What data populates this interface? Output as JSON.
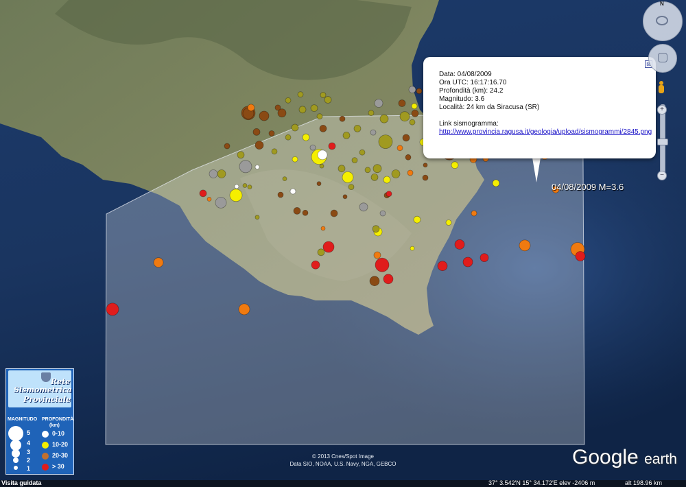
{
  "map": {
    "features": [
      "coastline",
      "land",
      "sea",
      "coverage-area"
    ]
  },
  "popup": {
    "data_line": "Data: 04/08/2009",
    "ora_line": "Ora UTC: 16:17:16.70",
    "profondita_line": "Profondità (km): 24.2",
    "magnitudo_line": "Magnitudo: 3.6",
    "localita_line": "Località: 24 km da Siracusa (SR)",
    "link_label": "Link sismogramma:",
    "link_url": "http://www.provincia.ragusa.it/geologia/upload/sismogrammi/2845.png",
    "close_glyph": "⊠"
  },
  "selected_event_label": "04/08/2009 M=3.6",
  "legend": {
    "logo_line1": "Rete",
    "logo_line2": "Sismometrica",
    "logo_line3": "Provinciale",
    "magnitudo_header": "MAGNITUDO",
    "profondita_header": "PROFONDITÀ",
    "km_label": "(km)",
    "magnitudes": [
      "5",
      "4",
      "3",
      "2",
      "1"
    ],
    "depths": [
      {
        "label": "0-10",
        "color": "#ffffff"
      },
      {
        "label": "10-20",
        "color": "#f5ef00"
      },
      {
        "label": "20-30",
        "color": "#c07030"
      },
      {
        "label": "> 30",
        "color": "#e01c1c"
      }
    ]
  },
  "copyright": {
    "line1": "© 2013 Cnes/Spot Image",
    "line2": "Data SIO, NOAA, U.S. Navy, NGA, GEBCO"
  },
  "logo": {
    "google": "Google",
    "earth": "earth"
  },
  "statusbar": {
    "guided_tour": "Visita guidata",
    "coords": "37° 3.542'N   15° 34.172'E  elev -2406 m",
    "altitude": "alt 198.96 km"
  },
  "colors": {
    "depth_0_10": "#ffffff",
    "depth_10_20": "#f5ef00",
    "depth_20_30": "#c07030",
    "depth_over_30": "#e01c1c",
    "olive": "#a09a20",
    "orange": "#f07a10",
    "brown": "#8a4a14"
  },
  "events": [
    {
      "lon": 0.788,
      "lat": 0.283,
      "r": 12,
      "c": "depth_10_20"
    },
    {
      "lon": 0.465,
      "lat": 0.322,
      "r": 11,
      "c": "depth_10_20"
    },
    {
      "lon": 0.562,
      "lat": 0.291,
      "r": 10,
      "c": "olive"
    },
    {
      "lon": 0.507,
      "lat": 0.364,
      "r": 8,
      "c": "depth_10_20"
    },
    {
      "lon": 0.344,
      "lat": 0.401,
      "r": 9,
      "c": "depth_10_20"
    },
    {
      "lon": 0.655,
      "lat": 0.313,
      "r": 11,
      "c": "brown"
    },
    {
      "lon": 0.557,
      "lat": 0.544,
      "r": 10,
      "c": "depth_over_30"
    },
    {
      "lon": 0.479,
      "lat": 0.507,
      "r": 8,
      "c": "depth_over_30"
    },
    {
      "lon": 0.362,
      "lat": 0.232,
      "r": 10,
      "c": "brown"
    },
    {
      "lon": 0.358,
      "lat": 0.342,
      "r": 9,
      "c": "grey"
    },
    {
      "lon": 0.322,
      "lat": 0.416,
      "r": 8,
      "c": "grey"
    },
    {
      "lon": 0.164,
      "lat": 0.635,
      "r": 9,
      "c": "depth_over_30"
    },
    {
      "lon": 0.356,
      "lat": 0.635,
      "r": 8,
      "c": "orange"
    },
    {
      "lon": 0.231,
      "lat": 0.539,
      "r": 7,
      "c": "orange"
    },
    {
      "lon": 0.842,
      "lat": 0.512,
      "r": 10,
      "c": "orange"
    },
    {
      "lon": 0.846,
      "lat": 0.526,
      "r": 7,
      "c": "depth_over_30"
    },
    {
      "lon": 0.765,
      "lat": 0.504,
      "r": 8,
      "c": "orange"
    },
    {
      "lon": 0.67,
      "lat": 0.502,
      "r": 7,
      "c": "depth_over_30"
    },
    {
      "lon": 0.706,
      "lat": 0.529,
      "r": 6,
      "c": "depth_over_30"
    },
    {
      "lon": 0.682,
      "lat": 0.538,
      "r": 7,
      "c": "depth_over_30"
    },
    {
      "lon": 0.645,
      "lat": 0.546,
      "r": 7,
      "c": "depth_over_30"
    },
    {
      "lon": 0.566,
      "lat": 0.573,
      "r": 7,
      "c": "depth_over_30"
    },
    {
      "lon": 0.546,
      "lat": 0.577,
      "r": 7,
      "c": "brown"
    },
    {
      "lon": 0.46,
      "lat": 0.544,
      "r": 6,
      "c": "depth_over_30"
    },
    {
      "lon": 0.551,
      "lat": 0.476,
      "r": 6,
      "c": "depth_10_20"
    },
    {
      "lon": 0.55,
      "lat": 0.524,
      "r": 5,
      "c": "orange"
    },
    {
      "lon": 0.468,
      "lat": 0.518,
      "r": 5,
      "c": "olive"
    },
    {
      "lon": 0.296,
      "lat": 0.397,
      "r": 5,
      "c": "depth_over_30"
    },
    {
      "lon": 0.311,
      "lat": 0.357,
      "r": 6,
      "c": "grey"
    },
    {
      "lon": 0.323,
      "lat": 0.357,
      "r": 6,
      "c": "olive"
    },
    {
      "lon": 0.362,
      "lat": 0.233,
      "r": 8,
      "c": "brown"
    },
    {
      "lon": 0.385,
      "lat": 0.238,
      "r": 7,
      "c": "brown"
    },
    {
      "lon": 0.411,
      "lat": 0.232,
      "r": 6,
      "c": "brown"
    },
    {
      "lon": 0.65,
      "lat": 0.241,
      "r": 8,
      "c": "brown"
    },
    {
      "lon": 0.687,
      "lat": 0.244,
      "r": 8,
      "c": "orange"
    },
    {
      "lon": 0.711,
      "lat": 0.235,
      "r": 6,
      "c": "orange"
    },
    {
      "lon": 0.772,
      "lat": 0.239,
      "r": 7,
      "c": "depth_over_30"
    },
    {
      "lon": 0.755,
      "lat": 0.262,
      "r": 6,
      "c": "depth_over_30"
    },
    {
      "lon": 0.766,
      "lat": 0.265,
      "r": 6,
      "c": "brown"
    },
    {
      "lon": 0.728,
      "lat": 0.308,
      "r": 6,
      "c": "orange"
    },
    {
      "lon": 0.794,
      "lat": 0.319,
      "r": 6,
      "c": "orange"
    },
    {
      "lon": 0.816,
      "lat": 0.303,
      "r": 5,
      "c": "orange"
    },
    {
      "lon": 0.81,
      "lat": 0.389,
      "r": 5,
      "c": "orange"
    },
    {
      "lon": 0.723,
      "lat": 0.376,
      "r": 5,
      "c": "depth_10_20"
    },
    {
      "lon": 0.69,
      "lat": 0.289,
      "r": 6,
      "c": "grey"
    },
    {
      "lon": 0.69,
      "lat": 0.327,
      "r": 5,
      "c": "orange"
    },
    {
      "lon": 0.708,
      "lat": 0.326,
      "r": 4,
      "c": "orange"
    },
    {
      "lon": 0.691,
      "lat": 0.438,
      "r": 4,
      "c": "orange"
    },
    {
      "lon": 0.654,
      "lat": 0.457,
      "r": 4,
      "c": "depth_10_20"
    },
    {
      "lon": 0.608,
      "lat": 0.451,
      "r": 5,
      "c": "depth_10_20"
    },
    {
      "lon": 0.601,
      "lat": 0.51,
      "r": 3,
      "c": "depth_10_20"
    },
    {
      "lon": 0.53,
      "lat": 0.425,
      "r": 6,
      "c": "grey"
    },
    {
      "lon": 0.487,
      "lat": 0.438,
      "r": 5,
      "c": "brown"
    },
    {
      "lon": 0.433,
      "lat": 0.433,
      "r": 5,
      "c": "brown"
    },
    {
      "lon": 0.445,
      "lat": 0.437,
      "r": 4,
      "c": "brown"
    },
    {
      "lon": 0.375,
      "lat": 0.446,
      "r": 3,
      "c": "olive"
    },
    {
      "lon": 0.564,
      "lat": 0.401,
      "r": 4,
      "c": "brown"
    },
    {
      "lon": 0.558,
      "lat": 0.438,
      "r": 4,
      "c": "grey"
    },
    {
      "lon": 0.548,
      "lat": 0.47,
      "r": 5,
      "c": "olive"
    },
    {
      "lon": 0.567,
      "lat": 0.398,
      "r": 4,
      "c": "depth_over_30"
    },
    {
      "lon": 0.471,
      "lat": 0.469,
      "r": 3,
      "c": "orange"
    },
    {
      "lon": 0.364,
      "lat": 0.384,
      "r": 3,
      "c": "olive"
    },
    {
      "lon": 0.427,
      "lat": 0.393,
      "r": 4,
      "c": "depth_0_10"
    },
    {
      "lon": 0.409,
      "lat": 0.4,
      "r": 4,
      "c": "brown"
    },
    {
      "lon": 0.512,
      "lat": 0.384,
      "r": 4,
      "c": "olive"
    },
    {
      "lon": 0.546,
      "lat": 0.364,
      "r": 5,
      "c": "olive"
    },
    {
      "lon": 0.564,
      "lat": 0.369,
      "r": 5,
      "c": "depth_10_20"
    },
    {
      "lon": 0.577,
      "lat": 0.357,
      "r": 6,
      "c": "olive"
    },
    {
      "lon": 0.598,
      "lat": 0.355,
      "r": 4,
      "c": "orange"
    },
    {
      "lon": 0.62,
      "lat": 0.339,
      "r": 3,
      "c": "brown"
    },
    {
      "lon": 0.663,
      "lat": 0.339,
      "r": 5,
      "c": "depth_10_20"
    },
    {
      "lon": 0.55,
      "lat": 0.346,
      "r": 6,
      "c": "olive"
    },
    {
      "lon": 0.536,
      "lat": 0.349,
      "r": 4,
      "c": "olive"
    },
    {
      "lon": 0.498,
      "lat": 0.346,
      "r": 5,
      "c": "olive"
    },
    {
      "lon": 0.484,
      "lat": 0.3,
      "r": 5,
      "c": "depth_over_30"
    },
    {
      "lon": 0.47,
      "lat": 0.318,
      "r": 7,
      "c": "depth_0_10"
    },
    {
      "lon": 0.456,
      "lat": 0.303,
      "r": 4,
      "c": "grey"
    },
    {
      "lon": 0.43,
      "lat": 0.327,
      "r": 4,
      "c": "depth_10_20"
    },
    {
      "lon": 0.4,
      "lat": 0.311,
      "r": 4,
      "c": "olive"
    },
    {
      "lon": 0.378,
      "lat": 0.298,
      "r": 6,
      "c": "brown"
    },
    {
      "lon": 0.351,
      "lat": 0.318,
      "r": 5,
      "c": "olive"
    },
    {
      "lon": 0.331,
      "lat": 0.3,
      "r": 4,
      "c": "brown"
    },
    {
      "lon": 0.374,
      "lat": 0.271,
      "r": 5,
      "c": "brown"
    },
    {
      "lon": 0.396,
      "lat": 0.274,
      "r": 4,
      "c": "brown"
    },
    {
      "lon": 0.43,
      "lat": 0.262,
      "r": 5,
      "c": "olive"
    },
    {
      "lon": 0.446,
      "lat": 0.282,
      "r": 5,
      "c": "depth_10_20"
    },
    {
      "lon": 0.471,
      "lat": 0.264,
      "r": 5,
      "c": "brown"
    },
    {
      "lon": 0.505,
      "lat": 0.278,
      "r": 5,
      "c": "olive"
    },
    {
      "lon": 0.521,
      "lat": 0.264,
      "r": 5,
      "c": "olive"
    },
    {
      "lon": 0.544,
      "lat": 0.272,
      "r": 4,
      "c": "grey"
    },
    {
      "lon": 0.592,
      "lat": 0.283,
      "r": 5,
      "c": "brown"
    },
    {
      "lon": 0.617,
      "lat": 0.292,
      "r": 5,
      "c": "depth_10_20"
    },
    {
      "lon": 0.63,
      "lat": 0.312,
      "r": 4,
      "c": "olive"
    },
    {
      "lon": 0.601,
      "lat": 0.251,
      "r": 4,
      "c": "olive"
    },
    {
      "lon": 0.59,
      "lat": 0.239,
      "r": 7,
      "c": "olive"
    },
    {
      "lon": 0.605,
      "lat": 0.233,
      "r": 5,
      "c": "brown"
    },
    {
      "lon": 0.56,
      "lat": 0.244,
      "r": 6,
      "c": "olive"
    },
    {
      "lon": 0.541,
      "lat": 0.232,
      "r": 4,
      "c": "olive"
    },
    {
      "lon": 0.499,
      "lat": 0.244,
      "r": 4,
      "c": "brown"
    },
    {
      "lon": 0.466,
      "lat": 0.239,
      "r": 4,
      "c": "olive"
    },
    {
      "lon": 0.441,
      "lat": 0.225,
      "r": 5,
      "c": "olive"
    },
    {
      "lon": 0.458,
      "lat": 0.222,
      "r": 5,
      "c": "olive"
    },
    {
      "lon": 0.42,
      "lat": 0.206,
      "r": 4,
      "c": "olive"
    },
    {
      "lon": 0.405,
      "lat": 0.221,
      "r": 4,
      "c": "brown"
    },
    {
      "lon": 0.478,
      "lat": 0.205,
      "r": 5,
      "c": "olive"
    },
    {
      "lon": 0.552,
      "lat": 0.212,
      "r": 6,
      "c": "grey"
    },
    {
      "lon": 0.586,
      "lat": 0.212,
      "r": 5,
      "c": "brown"
    },
    {
      "lon": 0.601,
      "lat": 0.184,
      "r": 5,
      "c": "grey"
    },
    {
      "lon": 0.611,
      "lat": 0.187,
      "r": 4,
      "c": "brown"
    },
    {
      "lon": 0.604,
      "lat": 0.218,
      "r": 4,
      "c": "depth_10_20"
    },
    {
      "lon": 0.636,
      "lat": 0.236,
      "r": 4,
      "c": "olive"
    },
    {
      "lon": 0.643,
      "lat": 0.269,
      "r": 6,
      "c": "brown"
    },
    {
      "lon": 0.665,
      "lat": 0.269,
      "r": 5,
      "c": "olive"
    },
    {
      "lon": 0.676,
      "lat": 0.275,
      "r": 4,
      "c": "orange"
    },
    {
      "lon": 0.7,
      "lat": 0.299,
      "r": 6,
      "c": "orange"
    },
    {
      "lon": 0.471,
      "lat": 0.195,
      "r": 4,
      "c": "olive"
    },
    {
      "lon": 0.438,
      "lat": 0.194,
      "r": 4,
      "c": "olive"
    },
    {
      "lon": 0.366,
      "lat": 0.221,
      "r": 5,
      "c": "orange"
    },
    {
      "lon": 0.42,
      "lat": 0.282,
      "r": 4,
      "c": "olive"
    },
    {
      "lon": 0.528,
      "lat": 0.313,
      "r": 4,
      "c": "olive"
    },
    {
      "lon": 0.583,
      "lat": 0.304,
      "r": 4,
      "c": "orange"
    },
    {
      "lon": 0.595,
      "lat": 0.323,
      "r": 4,
      "c": "brown"
    },
    {
      "lon": 0.517,
      "lat": 0.329,
      "r": 4,
      "c": "olive"
    },
    {
      "lon": 0.62,
      "lat": 0.365,
      "r": 4,
      "c": "brown"
    },
    {
      "lon": 0.465,
      "lat": 0.377,
      "r": 3,
      "c": "brown"
    },
    {
      "lon": 0.503,
      "lat": 0.404,
      "r": 3,
      "c": "brown"
    },
    {
      "lon": 0.469,
      "lat": 0.341,
      "r": 3,
      "c": "olive"
    },
    {
      "lon": 0.415,
      "lat": 0.367,
      "r": 3,
      "c": "olive"
    },
    {
      "lon": 0.375,
      "lat": 0.343,
      "r": 3,
      "c": "depth_0_10"
    },
    {
      "lon": 0.357,
      "lat": 0.381,
      "r": 3,
      "c": "olive"
    },
    {
      "lon": 0.345,
      "lat": 0.383,
      "r": 3,
      "c": "depth_0_10"
    },
    {
      "lon": 0.305,
      "lat": 0.409,
      "r": 3,
      "c": "orange"
    }
  ]
}
